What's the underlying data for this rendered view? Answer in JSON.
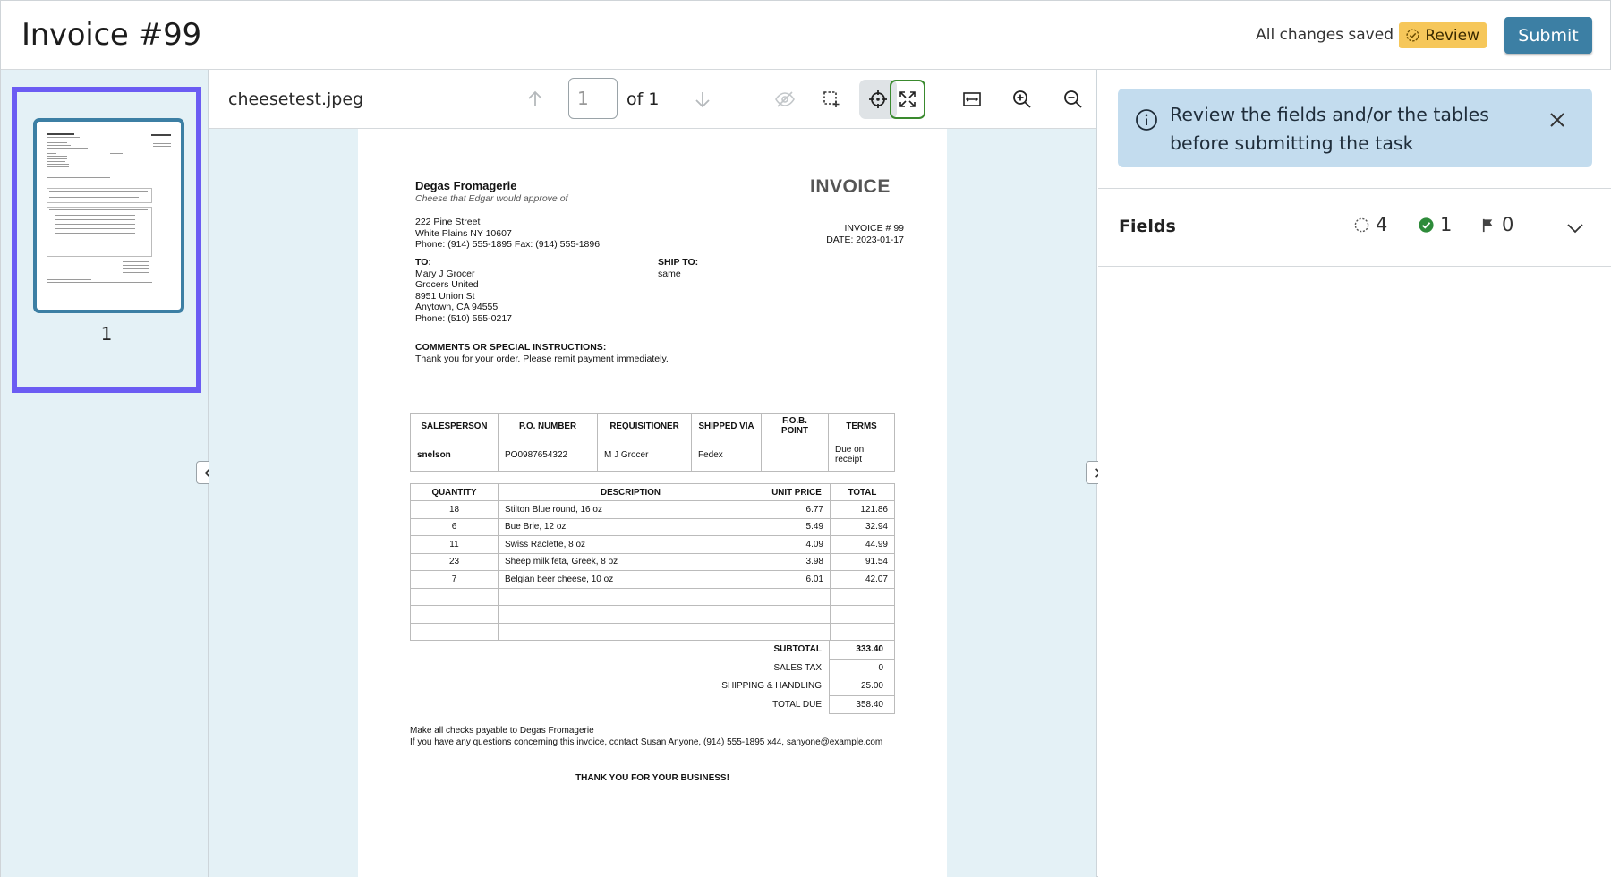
{
  "header": {
    "title": "Invoice #99",
    "save_status": "All changes saved",
    "review_label": "Review",
    "submit_label": "Submit"
  },
  "thumbnails": [
    {
      "page_number": "1",
      "selected": true
    }
  ],
  "viewer": {
    "filename": "cheesetest.jpeg",
    "page_input_value": "1",
    "page_of": "of 1",
    "icons": [
      "arrow-up-icon",
      "arrow-down-icon",
      "eye-off-icon",
      "select-region-icon",
      "crosshair-icon",
      "fit-page-icon",
      "fit-width-icon",
      "zoom-in-icon",
      "zoom-out-icon"
    ]
  },
  "invoice": {
    "company": "Degas Fromagerie",
    "tagline": "Cheese that Edgar would approve of",
    "doc_title": "INVOICE",
    "address": [
      "222 Pine Street",
      "White Plains NY 10607",
      "Phone: (914) 555-1895 Fax: (914) 555-1896"
    ],
    "invoice_number": "INVOICE # 99",
    "date": "DATE: 2023-01-17",
    "to_label": "TO:",
    "to_lines": [
      "Mary J Grocer",
      "Grocers United",
      "8951 Union St",
      "Anytown, CA 94555",
      "Phone: (510) 555-0217"
    ],
    "ship_to_label": "SHIP TO:",
    "ship_to_value": "same",
    "comments_label": "COMMENTS OR SPECIAL INSTRUCTIONS:",
    "comments_text": "Thank you for your order. Please remit payment immediately.",
    "order_headers": [
      "SALESPERSON",
      "P.O. NUMBER",
      "REQUISITIONER",
      "SHIPPED VIA",
      "F.O.B. POINT",
      "TERMS"
    ],
    "order_row": [
      "snelson",
      "PO0987654322",
      "M J Grocer",
      "Fedex",
      "",
      "Due on receipt"
    ],
    "item_headers": [
      "QUANTITY",
      "DESCRIPTION",
      "UNIT PRICE",
      "TOTAL"
    ],
    "items": [
      {
        "qty": "18",
        "desc": "Stilton Blue round, 16 oz",
        "unit": "6.77",
        "total": "121.86"
      },
      {
        "qty": "6",
        "desc": "Bue Brie, 12 oz",
        "unit": "5.49",
        "total": "32.94"
      },
      {
        "qty": "11",
        "desc": "Swiss Raclette, 8 oz",
        "unit": "4.09",
        "total": "44.99"
      },
      {
        "qty": "23",
        "desc": "Sheep milk feta, Greek, 8 oz",
        "unit": "3.98",
        "total": "91.54"
      },
      {
        "qty": "7",
        "desc": "Belgian beer cheese, 10 oz",
        "unit": "6.01",
        "total": "42.07"
      }
    ],
    "totals": [
      {
        "label": "SUBTOTAL",
        "value": "333.40",
        "bold": true
      },
      {
        "label": "SALES TAX",
        "value": "0"
      },
      {
        "label": "SHIPPING & HANDLING",
        "value": "25.00"
      },
      {
        "label": "TOTAL DUE",
        "value": "358.40"
      }
    ],
    "footer_line1": "Make all checks payable to Degas Fromagerie",
    "footer_line2": "If you have any questions concerning this invoice, contact Susan Anyone, (914) 555-1895 x44, sanyone@example.com",
    "thanks": "THANK YOU FOR YOUR BUSINESS!"
  },
  "right_panel": {
    "alert_text": "Review the fields and/or the tables before submitting the task",
    "fields_title": "Fields",
    "pending_count": "4",
    "done_count": "1",
    "flagged_count": "0"
  },
  "colors": {
    "accent": "#3c7fa4",
    "selection": "#6b5cf3",
    "review_badge": "#f6c75a",
    "alert_bg": "#c3dcee",
    "panel_bg": "#e4f1f6",
    "done_green": "#2e8b3a",
    "active_tool_outline": "#3a8a2e"
  }
}
